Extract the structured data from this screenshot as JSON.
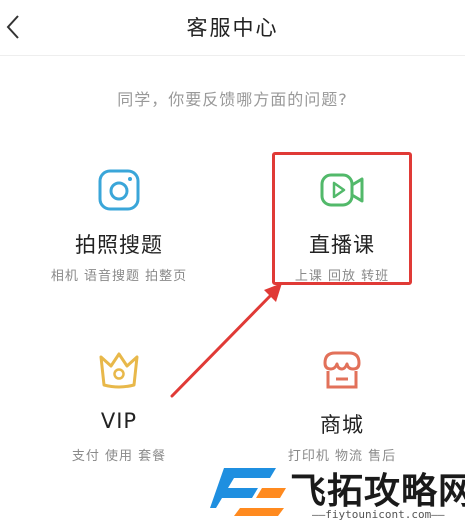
{
  "header": {
    "title": "客服中心",
    "back_icon": "chevron-left-icon"
  },
  "question": "同学，你要反馈哪方面的问题?",
  "tiles": [
    {
      "name": "拍照搜题",
      "desc": "相机 语音搜题 拍整页",
      "icon": "camera-icon",
      "color": "#3aa6d9"
    },
    {
      "name": "直播课",
      "desc": "上课 回放 转班",
      "icon": "video-camera-icon",
      "color": "#52b96a"
    },
    {
      "name": "VIP",
      "desc": "支付 使用 套餐",
      "icon": "crown-icon",
      "color": "#e8b84a"
    },
    {
      "name": "商城",
      "desc": "打印机 物流 售后",
      "icon": "shop-icon",
      "color": "#e2715a"
    }
  ],
  "annotation": {
    "color": "#e03a36"
  },
  "watermark": {
    "brand": "飞拓攻略网",
    "url": "——fiytounicont.com——"
  }
}
